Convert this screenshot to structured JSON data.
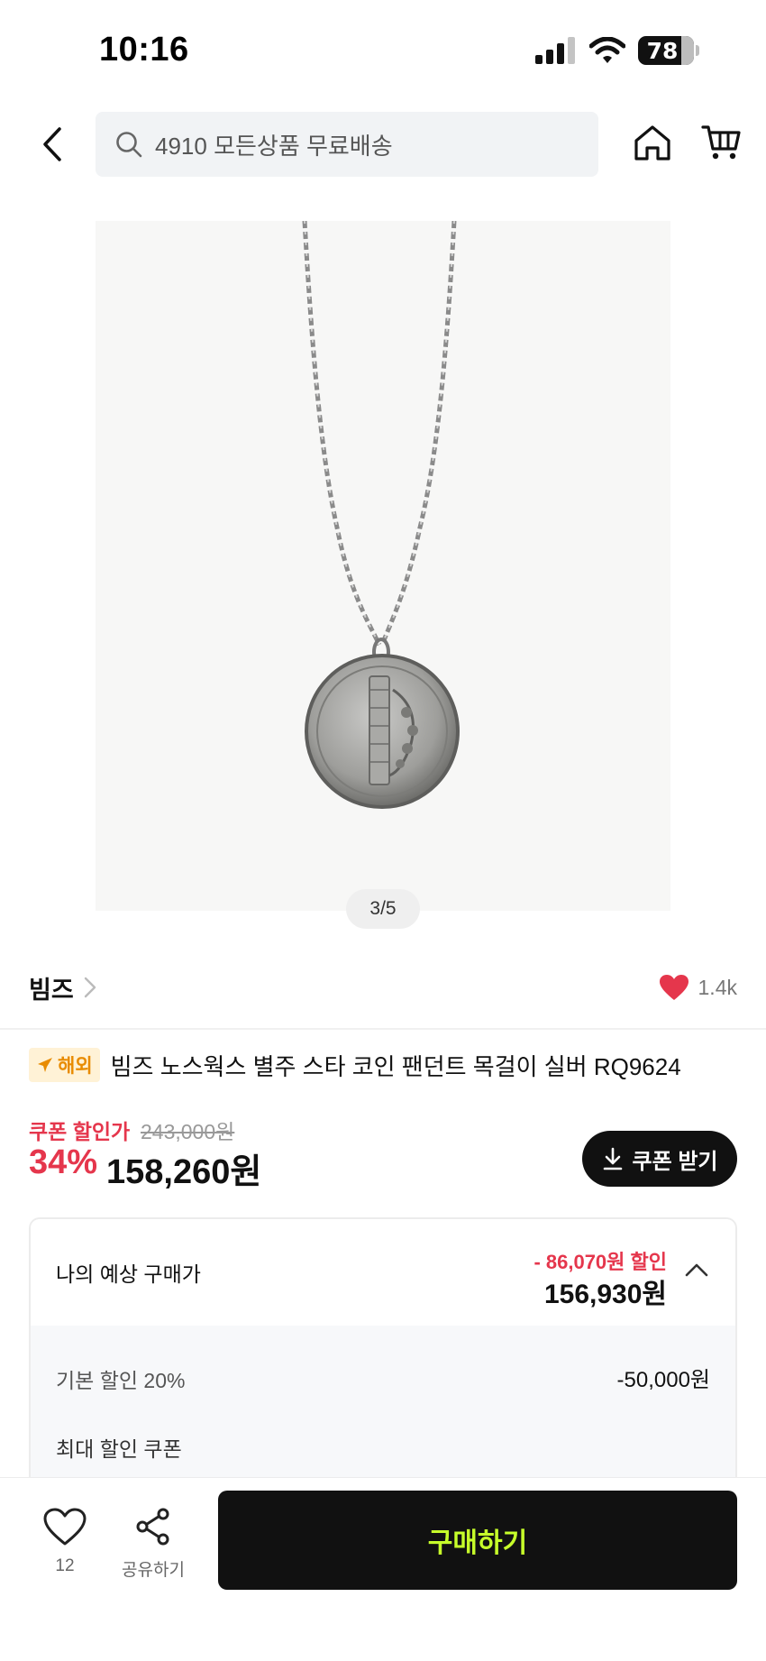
{
  "status_bar": {
    "time": "10:16",
    "battery": "78",
    "battery_level": 0.78
  },
  "header": {
    "search_text": "4910 모든상품 무료배송"
  },
  "gallery": {
    "indicator": "3/5"
  },
  "brand": {
    "name": "빔즈",
    "likes": "1.4k"
  },
  "product": {
    "badge": "해외",
    "title": "빔즈 노스웍스 별주 스타 코인 팬던트 목걸이 실버 RQ9624"
  },
  "price": {
    "coupon_label": "쿠폰 할인가",
    "original": "243,000원",
    "discount_rate": "34%",
    "sale": "158,260원",
    "coupon_button": "쿠폰 받기"
  },
  "expected": {
    "label": "나의 예상 구매가",
    "discount": "- 86,070원 할인",
    "price": "156,930원",
    "base_discount_label": "기본 할인 20%",
    "base_discount_value": "-50,000원",
    "max_coupon_label": "최대 할인 쿠폰"
  },
  "bottom": {
    "wish_count": "12",
    "share_label": "공유하기",
    "buy_label": "구매하기"
  },
  "colors": {
    "accent_red": "#e5364c",
    "buy_text": "#c7ff2a",
    "badge_orange": "#e88b00"
  }
}
